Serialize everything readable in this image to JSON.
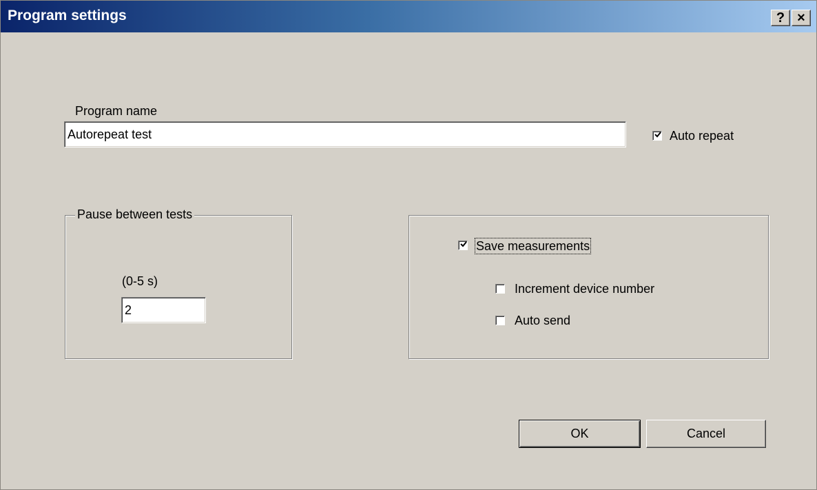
{
  "window": {
    "title": "Program settings",
    "help_button": "?",
    "close_button": "×"
  },
  "program": {
    "name_label": "Program name",
    "name_value": "Autorepeat test",
    "auto_repeat_label": "Auto repeat",
    "auto_repeat_checked": true
  },
  "pause_group": {
    "legend": "Pause between tests",
    "range_label": "(0-5 s)",
    "value": "2"
  },
  "measurement_group": {
    "save_measurements_label": "Save measurements",
    "save_measurements_checked": true,
    "increment_device_label": "Increment device number",
    "increment_device_checked": false,
    "auto_send_label": "Auto send",
    "auto_send_checked": false
  },
  "buttons": {
    "ok_label": "OK",
    "cancel_label": "Cancel"
  }
}
